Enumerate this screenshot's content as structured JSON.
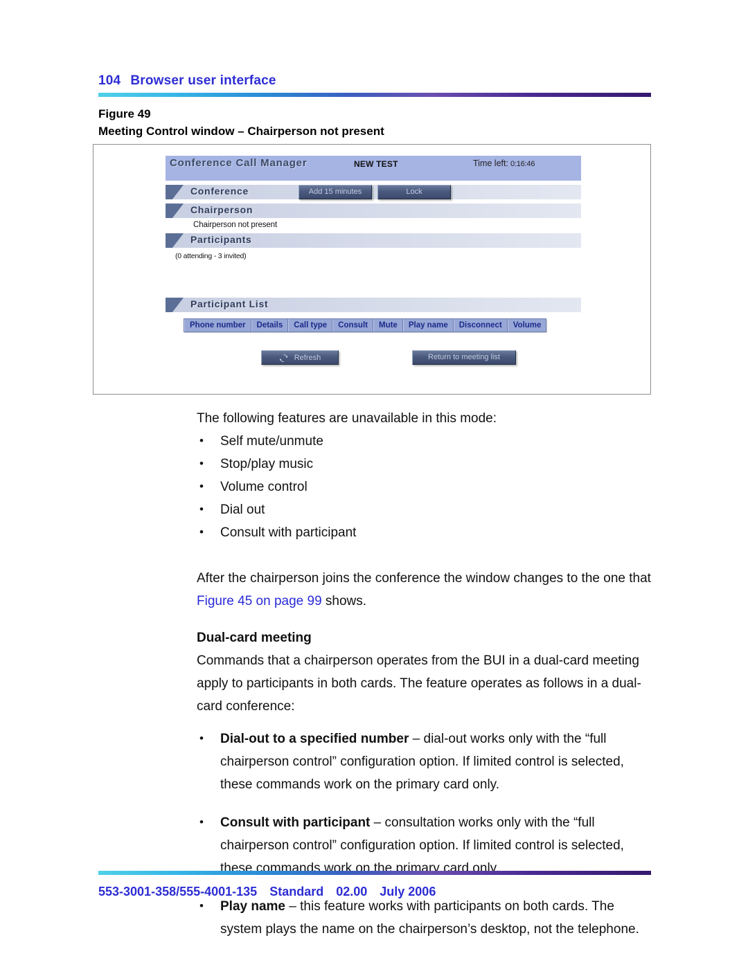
{
  "header": {
    "page_number": "104",
    "section_title": "Browser user interface",
    "rule_gradient_start": "#4fd1e8",
    "rule_gradient_end": "#37196f",
    "text_color": "#2d2dd4"
  },
  "figure": {
    "label": "Figure 49",
    "title": "Meeting Control window – Chairperson not present",
    "app": {
      "app_name": "Conference Call Manager",
      "meeting_name": "NEW TEST",
      "time_left_label": "Time left:",
      "time_left_value": "0:16:46",
      "titlebar_color": "#a6b4e4",
      "sections": {
        "conference": "Conference",
        "chairperson": "Chairperson",
        "participants": "Participants",
        "participant_list": "Participant List"
      },
      "buttons": {
        "add_minutes": "Add 15 minutes",
        "lock": "Lock",
        "refresh": "Refresh",
        "return_to_list": "Return to meeting list"
      },
      "status": {
        "chairperson_status": "Chairperson not present",
        "participant_count": "(0 attending - 3 invited)"
      },
      "table_headers": [
        "Phone number",
        "Details",
        "Call type",
        "Consult",
        "Mute",
        "Play name",
        "Disconnect",
        "Volume"
      ]
    }
  },
  "body": {
    "intro": "The following features are unavailable in this mode:",
    "unavailable_features": [
      "Self mute/unmute",
      "Stop/play music",
      "Volume control",
      "Dial out",
      "Consult with participant"
    ],
    "after_join_part1": "After the chairperson joins the conference the window changes to the one that ",
    "after_join_link": "Figure 45 on page 99",
    "after_join_part2": " shows.",
    "dual_card_heading": "Dual-card meeting",
    "dual_card_intro": "Commands that a chairperson operates from the BUI in a dual-card meeting apply to participants in both cards. The feature operates as follows in a dual-card conference:",
    "dual_card_items": [
      {
        "term": "Dial-out to a specified number",
        "description": " – dial-out works only with the “full chairperson control” configuration option. If limited control is selected, these commands work on the primary card only."
      },
      {
        "term": "Consult with participant",
        "description": " – consultation works only with the “full chairperson control” configuration option. If limited control is selected, these commands work on the primary card only."
      },
      {
        "term": "Play name",
        "description": " – this feature works with participants on both cards. The system plays the name on the chairperson’s desktop, not the telephone."
      }
    ]
  },
  "footer": {
    "doc_number": "553-3001-358/555-4001-135",
    "status": "Standard",
    "version": "02.00",
    "date": "July 2006",
    "text_color": "#2d2dd4"
  }
}
